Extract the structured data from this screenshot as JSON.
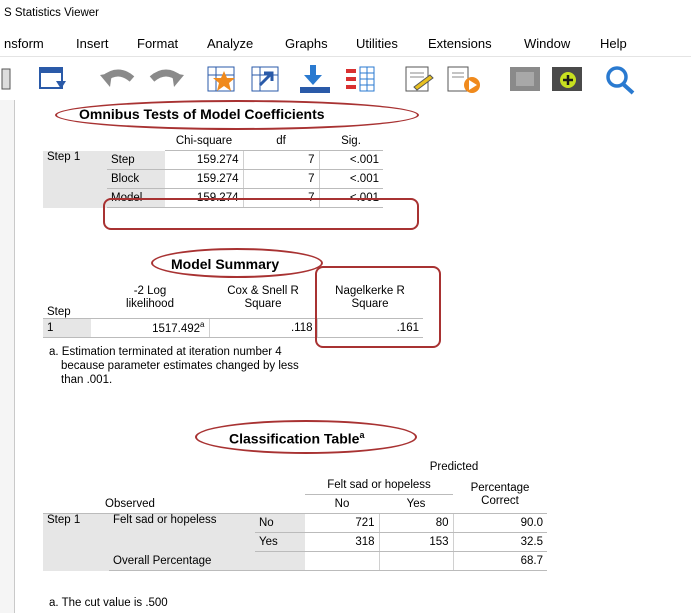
{
  "window": {
    "title": "S Statistics Viewer"
  },
  "menu": [
    {
      "label": "nsform"
    },
    {
      "label": "Insert"
    },
    {
      "label": "Format"
    },
    {
      "label": "Analyze"
    },
    {
      "label": "Graphs"
    },
    {
      "label": "Utilities"
    },
    {
      "label": "Extensions"
    },
    {
      "label": "Window"
    },
    {
      "label": "Help"
    }
  ],
  "toolbar_icons": [
    "open-file-icon",
    "window-icon",
    "undo-icon",
    "redo-icon",
    "goto-case-icon",
    "goto-variable-icon",
    "insert-output-icon",
    "select-cases-icon",
    "edit-icon",
    "run-icon",
    "hide-icon",
    "add-output-icon",
    "search-icon"
  ],
  "omnibus": {
    "title": "Omnibus Tests of Model Coefficients",
    "headers": [
      "Chi-square",
      "df",
      "Sig."
    ],
    "group": "Step 1",
    "rows": [
      {
        "label": "Step",
        "chi": "159.274",
        "df": "7",
        "sig": "<.001"
      },
      {
        "label": "Block",
        "chi": "159.274",
        "df": "7",
        "sig": "<.001"
      },
      {
        "label": "Model",
        "chi": "159.274",
        "df": "7",
        "sig": "<.001"
      }
    ]
  },
  "model_summary": {
    "title": "Model Summary",
    "headers": {
      "step": "Step",
      "ll": "-2 Log\nlikelihood",
      "cox": "Cox & Snell R\nSquare",
      "nag": "Nagelkerke R\nSquare"
    },
    "row": {
      "step": "1",
      "ll": "1517.492",
      "ll_sup": "a",
      "cox": ".118",
      "nag": ".161"
    },
    "footnote_a": "a. Estimation terminated at iteration number 4",
    "footnote_b": "because parameter estimates changed by less",
    "footnote_c": "than .001."
  },
  "classification": {
    "title": "Classification Table",
    "title_sup": "a",
    "predicted": "Predicted",
    "felt": "Felt sad or hopeless",
    "no": "No",
    "yes": "Yes",
    "pct": "Percentage",
    "correct": "Correct",
    "observed": "Observed",
    "step": "Step 1",
    "var": "Felt sad or hopeless",
    "r1": {
      "label": "No",
      "no": "721",
      "yes": "80",
      "pct": "90.0"
    },
    "r2": {
      "label": "Yes",
      "no": "318",
      "yes": "153",
      "pct": "32.5"
    },
    "overall": {
      "label": "Overall Percentage",
      "pct": "68.7"
    },
    "footnote": "a. The cut value is .500"
  },
  "colors": {
    "accent": "#a83232",
    "label_bg": "#e6e6e6"
  }
}
